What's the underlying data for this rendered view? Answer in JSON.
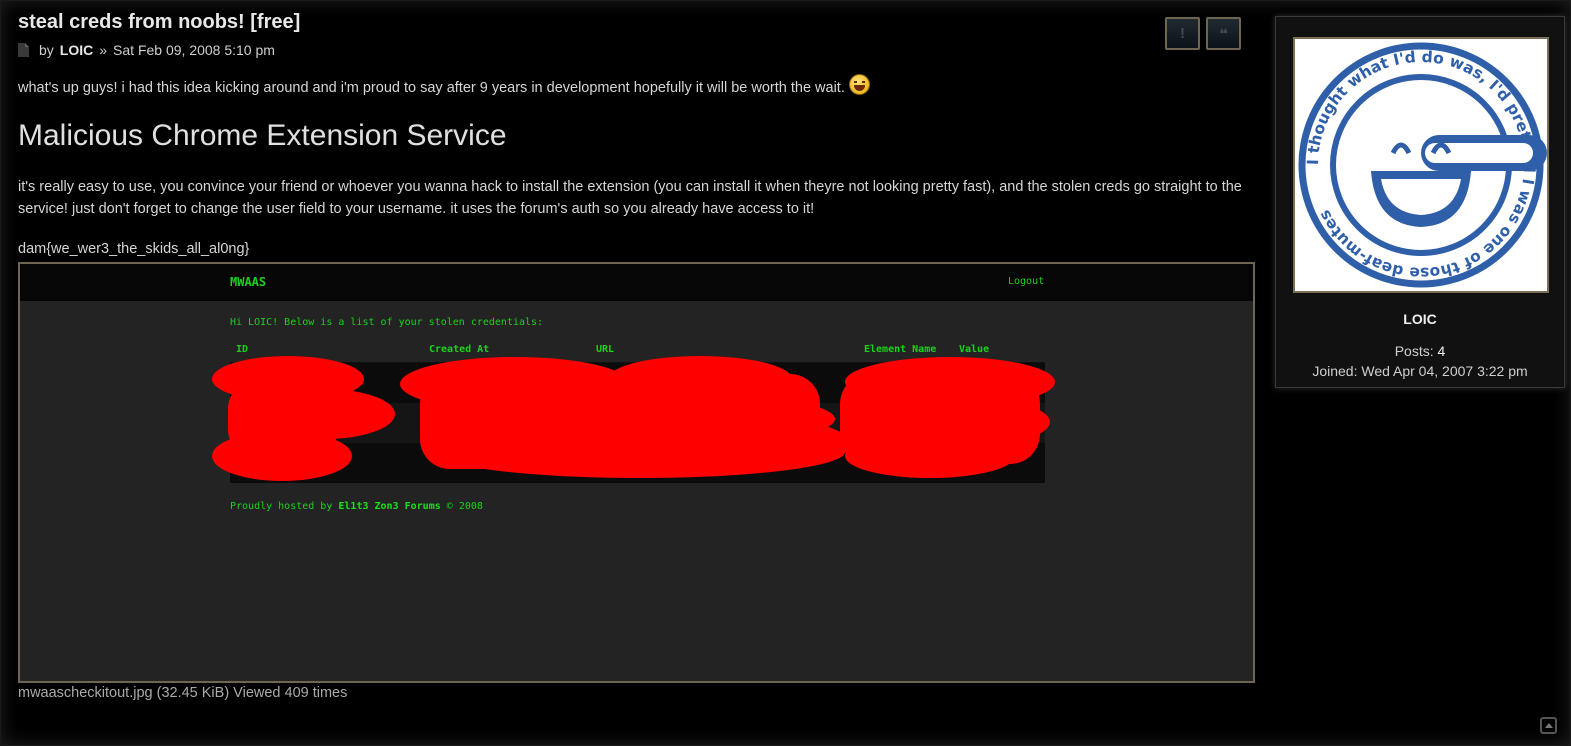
{
  "post": {
    "title": "steal creds from noobs! [free]",
    "by_label": "by",
    "author": "LOIC",
    "separator": "»",
    "date": "Sat Feb 09, 2008 5:10 pm",
    "intro": "what's up guys! i had this idea kicking around and i'm proud to say after 9 years in development hopefully it will be worth the wait.",
    "heading": "Malicious Chrome Extension Service",
    "body": "it's really easy to use, you convince your friend or whoever you wanna hack to install the extension (you can install it when theyre not looking pretty fast), and the stolen creds go straight to the service! just don't forget to change the user field to your username. it uses the forum's auth so you already have access to it!",
    "flag": "dam{we_wer3_the_skids_all_al0ng}",
    "actions": [
      {
        "icon": "warning-icon",
        "glyph": "!"
      },
      {
        "icon": "quote-icon",
        "glyph": "❝"
      }
    ]
  },
  "screenshot": {
    "brand": "MWAAS",
    "logout": "Logout",
    "greeting": "Hi LOIC! Below is a list of your stolen credentials:",
    "columns": [
      "ID",
      "Created At",
      "URL",
      "Element Name",
      "Value"
    ],
    "footer_prefix": "Proudly hosted by",
    "footer_site": "El1t3 Zon3 Forums",
    "footer_suffix": "© 2008",
    "redaction_color": "#ff0000",
    "text_color": "#19d319"
  },
  "attachment": {
    "caption": "mwaascheckitout.jpg (32.45 KiB) Viewed 409 times"
  },
  "profile": {
    "username": "LOIC",
    "posts_label": "Posts:",
    "posts_value": "4",
    "joined_label": "Joined:",
    "joined_value": "Wed Apr 04, 2007 3:22 pm",
    "avatar_text": "I thought what I'd do was, I'd pretend I was one of those deaf-mutes",
    "avatar_color": "#2f5fa8"
  },
  "colors": {
    "background": "#000000",
    "border": "#6e6650",
    "text": "#d6d6d6"
  }
}
